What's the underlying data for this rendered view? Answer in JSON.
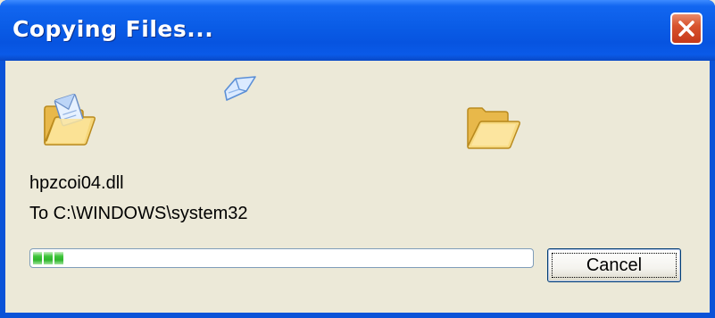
{
  "window": {
    "title": "Copying Files..."
  },
  "icons": {
    "source": "source-folder-icon",
    "flying": "flying-document-icon",
    "destination": "destination-folder-icon",
    "close": "close-icon"
  },
  "status": {
    "filename": "hpzcoi04.dll",
    "destination": "To C:\\WINDOWS\\system32"
  },
  "progress": {
    "fraction": 0.06,
    "segments": 3
  },
  "buttons": {
    "cancel_label": "Cancel"
  },
  "colors": {
    "titlebar": "#0a5ce6",
    "close_button": "#d8542e",
    "progress_fill": "#3ec53a",
    "dialog_background": "#ece9d8"
  }
}
